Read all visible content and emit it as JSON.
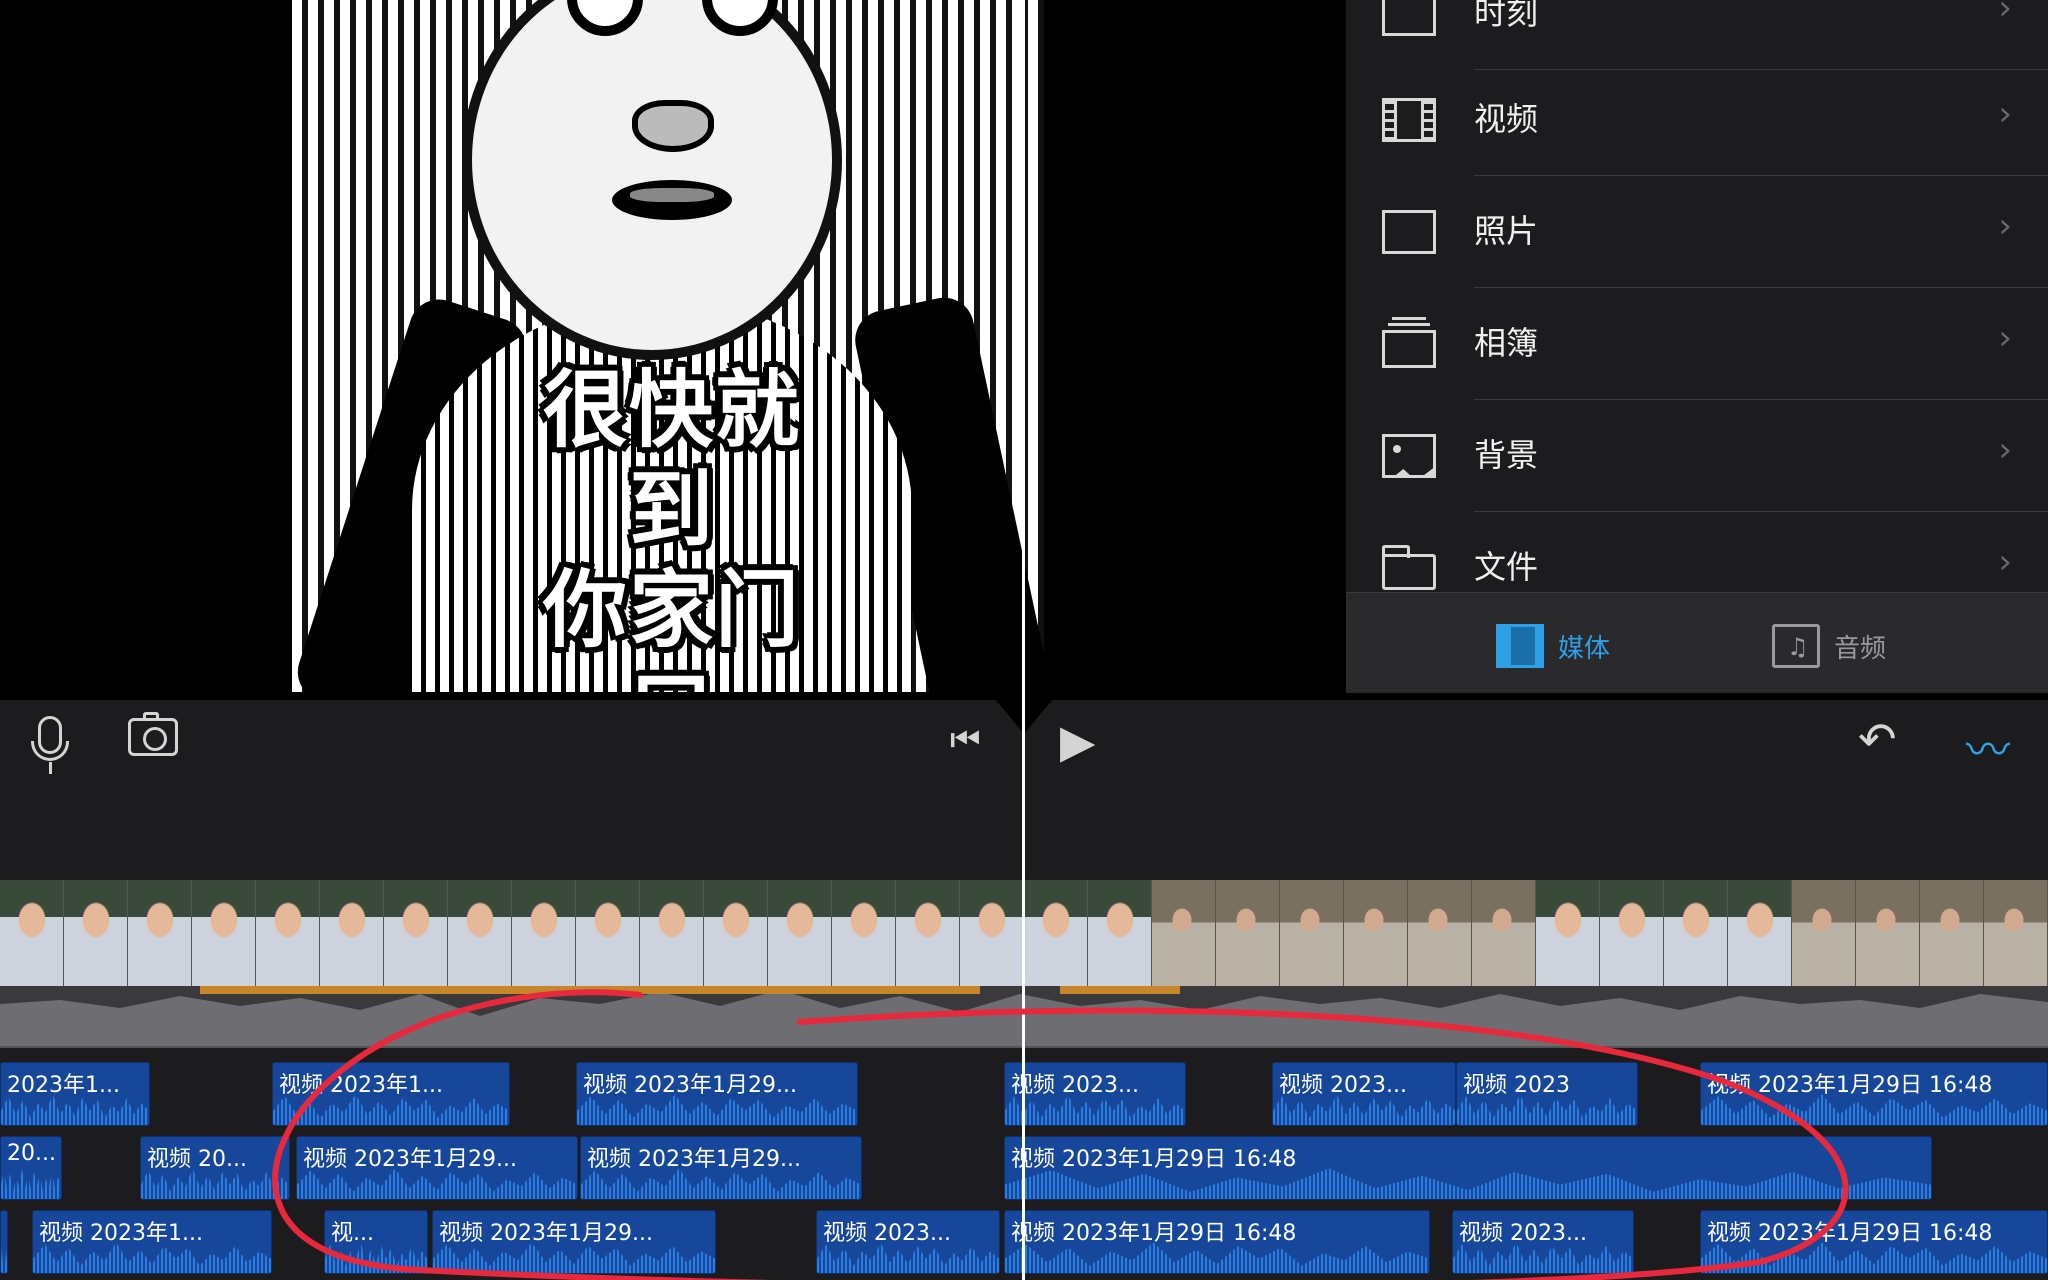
{
  "preview": {
    "caption_line1": "很快就到",
    "caption_line2": "你家门口"
  },
  "browser": {
    "rows": [
      {
        "label": "时刻",
        "icon": "moments-icon"
      },
      {
        "label": "视频",
        "icon": "film-icon"
      },
      {
        "label": "照片",
        "icon": "photo-frame-icon"
      },
      {
        "label": "相簿",
        "icon": "album-stack-icon"
      },
      {
        "label": "背景",
        "icon": "background-image-icon"
      },
      {
        "label": "文件",
        "icon": "folder-icon"
      }
    ],
    "chevron": "›",
    "tabs": {
      "media": "媒体",
      "audio": "音频"
    },
    "accent": "#2ea0e6"
  },
  "toolbar": {
    "skip_back_glyph": "⏮",
    "play_glyph": "▶",
    "undo_glyph": "↶",
    "waveform_glyph": "〰"
  },
  "timeline": {
    "row1": [
      "2023年1...",
      "视频 2023年1...",
      "视频 2023年1月29...",
      "视频 2023...",
      "视频 2023...",
      "视频 2023",
      "视频 2023年1月29日 16:48"
    ],
    "row2": [
      "20...",
      "视频 20...",
      "视频 2023年1月29...",
      "视频 2023年1月29...",
      "视频 2023年1月29日 16:48"
    ],
    "row3": [
      "",
      "视频 2023年1...",
      "视...",
      "视频 2023年1月29...",
      "视频 2023...",
      "视频 2023年1月29日 16:48",
      "视频 2023...",
      "视频 2023年1月29日 16:48"
    ],
    "annotation_color": "#e8283c",
    "clip_color": "#16479a"
  }
}
